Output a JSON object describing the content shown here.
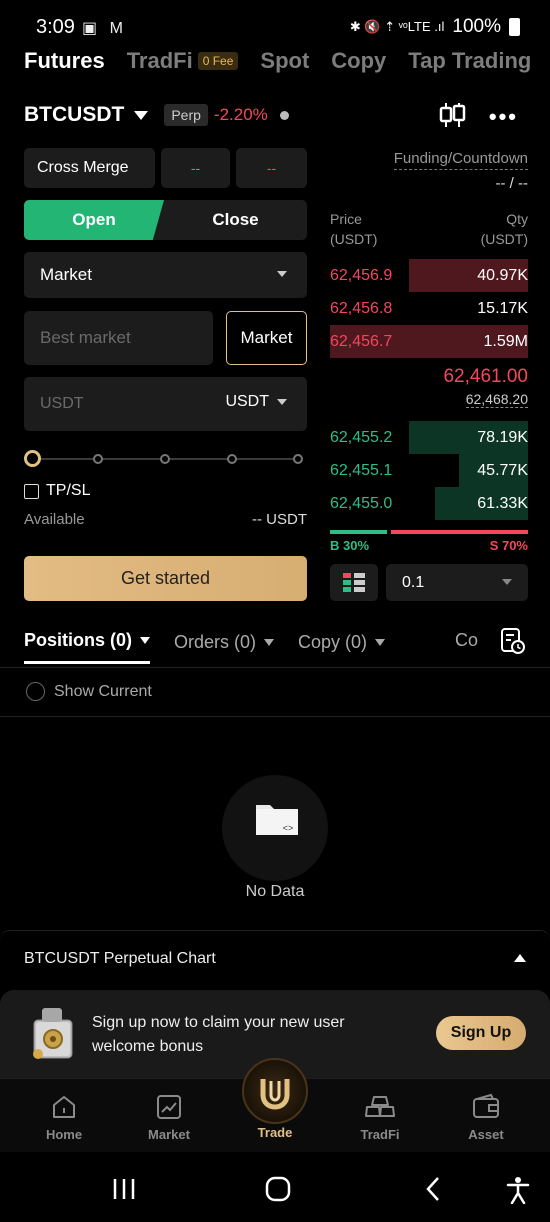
{
  "status_bar": {
    "time": "3:09",
    "icons": "▣ M",
    "network": "✱ 🔇 ⇡ ᵛᵒLTE .ıl",
    "battery": "100%"
  },
  "top_tabs": {
    "futures": "Futures",
    "tradfi": "TradFi",
    "tradfi_badge": "0 Fee",
    "spot": "Spot",
    "copy": "Copy",
    "tap_trading": "Tap Trading"
  },
  "symbol": {
    "name": "BTCUSDT",
    "type": "Perp",
    "change": "-2.20%"
  },
  "order_form": {
    "margin_mode": "Cross Merge",
    "leverage_long": "--",
    "leverage_short": "--",
    "open_label": "Open",
    "close_label": "Close",
    "order_type": "Market",
    "price_placeholder": "Best market",
    "price_mode": "Market",
    "amount_placeholder": "USDT",
    "amount_unit": "USDT",
    "tpsl_label": "TP/SL",
    "available_label": "Available",
    "available_value": "-- USDT",
    "cta": "Get started"
  },
  "order_book": {
    "funding_label": "Funding/Countdown",
    "funding_value": "-- / --",
    "price_header": "Price\n(USDT)",
    "qty_header": "Qty\n(USDT)",
    "price_header_l1": "Price",
    "price_header_l2": "(USDT)",
    "qty_header_l1": "Qty",
    "qty_header_l2": "(USDT)",
    "asks": [
      {
        "price": "62,456.9",
        "qty": "40.97K",
        "depth": 0.6
      },
      {
        "price": "62,456.8",
        "qty": "15.17K",
        "depth": 0.0
      },
      {
        "price": "62,456.7",
        "qty": "1.59M",
        "depth": 1.0
      }
    ],
    "last_price": "62,461.00",
    "mark_price": "62,468.20",
    "bids": [
      {
        "price": "62,455.2",
        "qty": "78.19K",
        "depth": 0.6
      },
      {
        "price": "62,455.1",
        "qty": "45.77K",
        "depth": 0.35
      },
      {
        "price": "62,455.0",
        "qty": "61.33K",
        "depth": 0.47
      }
    ],
    "buy_ratio_label": "B 30%",
    "sell_ratio_label": "S 70%",
    "buy_ratio": 0.3,
    "depth_step": "0.1"
  },
  "positions": {
    "tabs": [
      "Positions (0)",
      "Orders (0)",
      "Copy (0)",
      "Co"
    ],
    "show_current": "Show Current",
    "empty_text": "No Data"
  },
  "chart_panel": {
    "title": "BTCUSDT Perpetual Chart"
  },
  "promo": {
    "text": "Sign up now to claim your new user welcome bonus",
    "button": "Sign Up"
  },
  "bottom_nav": {
    "home": "Home",
    "market": "Market",
    "trade": "Trade",
    "tradfi": "TradFi",
    "asset": "Asset"
  },
  "colors": {
    "up": "#2ebd85",
    "down": "#f6465d",
    "accent_gold": "#e1c083",
    "open_green": "#22b573"
  }
}
